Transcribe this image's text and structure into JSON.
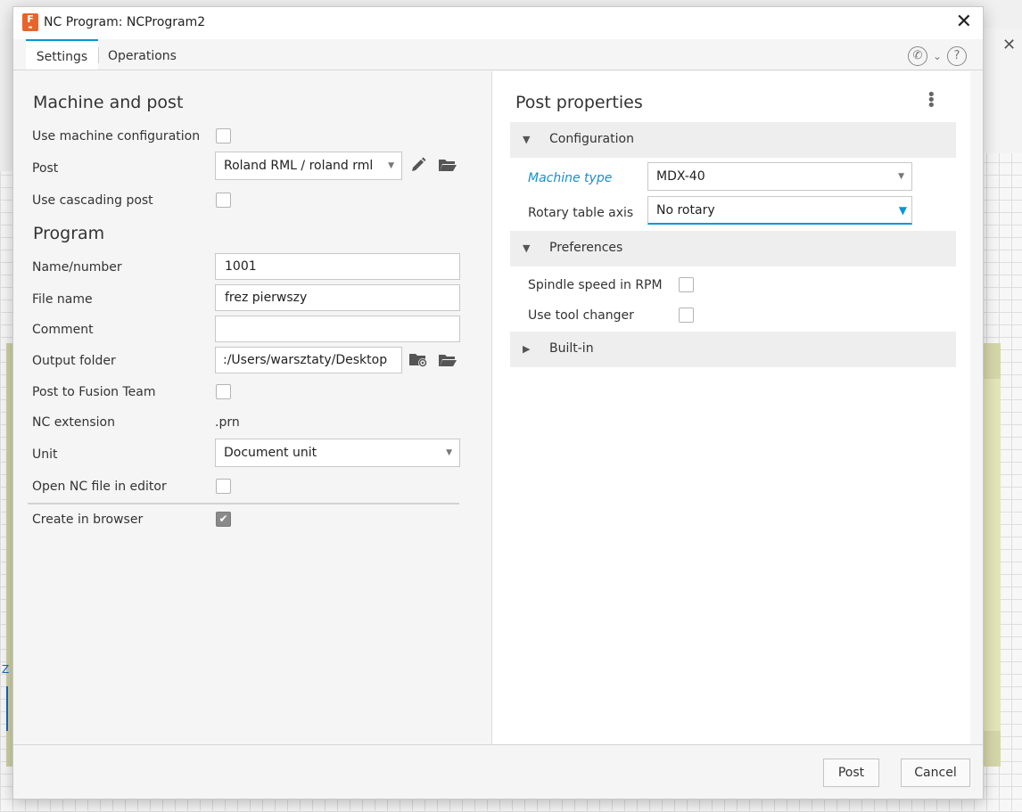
{
  "dialog": {
    "title": "NC Program: NCProgram2",
    "app_icon_letter": "F",
    "tabs": [
      {
        "label": "Settings",
        "active": true
      },
      {
        "label": "Operations",
        "active": false
      }
    ]
  },
  "machine_and_post": {
    "title": "Machine and post",
    "use_machine_configuration": {
      "label": "Use machine configuration",
      "checked": false
    },
    "post": {
      "label": "Post",
      "value": "Roland RML / roland rml"
    },
    "use_cascading_post": {
      "label": "Use cascading post",
      "checked": false
    }
  },
  "program": {
    "title": "Program",
    "name_number": {
      "label": "Name/number",
      "value": "1001"
    },
    "file_name": {
      "label": "File name",
      "value": "frez pierwszy"
    },
    "comment": {
      "label": "Comment",
      "value": ""
    },
    "output_folder": {
      "label": "Output folder",
      "value": ":/Users/warsztaty/Desktop"
    },
    "post_to_fusion_team": {
      "label": "Post to Fusion Team",
      "checked": false
    },
    "nc_extension": {
      "label": "NC extension",
      "value": ".prn"
    },
    "unit": {
      "label": "Unit",
      "value": "Document unit"
    },
    "open_nc_file_in_editor": {
      "label": "Open NC file in editor",
      "checked": false
    },
    "create_in_browser": {
      "label": "Create in browser",
      "checked": true
    }
  },
  "post_properties": {
    "title": "Post properties",
    "configuration": {
      "label": "Configuration",
      "machine_type": {
        "label": "Machine type",
        "value": "MDX-40"
      },
      "rotary_table_axis": {
        "label": "Rotary table axis",
        "value": "No rotary"
      }
    },
    "preferences": {
      "label": "Preferences",
      "spindle_speed_in_rpm": {
        "label": "Spindle speed in RPM",
        "checked": false
      },
      "use_tool_changer": {
        "label": "Use tool changer",
        "checked": false
      }
    },
    "built_in": {
      "label": "Built-in"
    }
  },
  "footer": {
    "post_button": "Post",
    "cancel_button": "Cancel"
  },
  "background": {
    "axis_label": "Z"
  },
  "colors": {
    "accent": "#0696d7",
    "app_icon": "#e8642a",
    "machine_type_label": "#1a8fc9"
  }
}
